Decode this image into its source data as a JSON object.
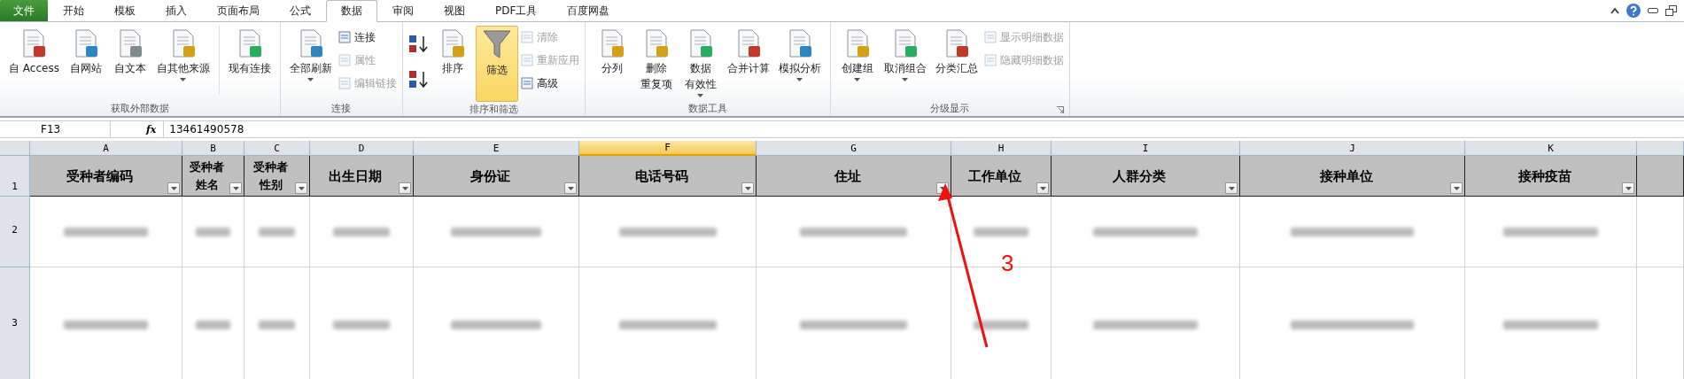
{
  "tabs": [
    {
      "label": "文件",
      "kind": "file",
      "selected": false
    },
    {
      "label": "开始",
      "kind": "tab",
      "selected": false
    },
    {
      "label": "模板",
      "kind": "tab",
      "selected": false
    },
    {
      "label": "插入",
      "kind": "tab",
      "selected": false
    },
    {
      "label": "页面布局",
      "kind": "tab",
      "selected": false
    },
    {
      "label": "公式",
      "kind": "tab",
      "selected": false
    },
    {
      "label": "数据",
      "kind": "tab",
      "selected": true
    },
    {
      "label": "审阅",
      "kind": "tab",
      "selected": false
    },
    {
      "label": "视图",
      "kind": "tab",
      "selected": false
    },
    {
      "label": "PDF工具",
      "kind": "tab",
      "selected": false
    },
    {
      "label": "百度网盘",
      "kind": "tab",
      "selected": false
    }
  ],
  "ribbon_groups": [
    {
      "label": "获取外部数据",
      "launcher": false,
      "items": [
        {
          "kind": "large",
          "label": "自 Access",
          "dropdown": false,
          "disabled": false
        },
        {
          "kind": "large",
          "label": "自网站",
          "dropdown": false,
          "disabled": false
        },
        {
          "kind": "large",
          "label": "自文本",
          "dropdown": false,
          "disabled": false
        },
        {
          "kind": "large",
          "label": "自其他来源",
          "dropdown": true,
          "disabled": false
        },
        {
          "kind": "separator"
        },
        {
          "kind": "large",
          "label": "现有连接",
          "dropdown": false,
          "disabled": false
        }
      ]
    },
    {
      "label": "连接",
      "launcher": false,
      "items": [
        {
          "kind": "large",
          "label": "全部刷新",
          "dropdown": true,
          "disabled": false
        },
        {
          "kind": "stack",
          "items": [
            {
              "label": "连接",
              "disabled": false
            },
            {
              "label": "属性",
              "disabled": true
            },
            {
              "label": "编辑链接",
              "disabled": true
            }
          ]
        }
      ]
    },
    {
      "label": "排序和筛选",
      "launcher": false,
      "items": [
        {
          "kind": "sort"
        },
        {
          "kind": "large",
          "label": "排序",
          "dropdown": false,
          "disabled": false
        },
        {
          "kind": "toggle",
          "label": "筛选",
          "selected": true
        },
        {
          "kind": "stack",
          "items": [
            {
              "label": "清除",
              "disabled": true
            },
            {
              "label": "重新应用",
              "disabled": true
            },
            {
              "label": "高级",
              "disabled": false
            }
          ]
        }
      ]
    },
    {
      "label": "数据工具",
      "launcher": false,
      "items": [
        {
          "kind": "large",
          "label": "分列",
          "dropdown": false,
          "disabled": false
        },
        {
          "kind": "large",
          "lines": [
            "删除",
            "重复项"
          ],
          "dropdown": false,
          "disabled": false
        },
        {
          "kind": "large",
          "lines": [
            "数据",
            "有效性"
          ],
          "dropdown": true,
          "disabled": false
        },
        {
          "kind": "large",
          "label": "合并计算",
          "dropdown": false,
          "disabled": false
        },
        {
          "kind": "large",
          "label": "模拟分析",
          "dropdown": true,
          "disabled": false
        }
      ]
    },
    {
      "label": "分级显示",
      "launcher": true,
      "items": [
        {
          "kind": "large",
          "label": "创建组",
          "dropdown": true,
          "disabled": false
        },
        {
          "kind": "large",
          "label": "取消组合",
          "dropdown": true,
          "disabled": false
        },
        {
          "kind": "large",
          "label": "分类汇总",
          "dropdown": false,
          "disabled": false
        },
        {
          "kind": "stack",
          "items": [
            {
              "label": "显示明细数据",
              "disabled": true
            },
            {
              "label": "隐藏明细数据",
              "disabled": true
            }
          ]
        }
      ]
    }
  ],
  "formula_bar": {
    "name_box": "F13",
    "fx": "fx",
    "value": "13461490578"
  },
  "columns": [
    {
      "letter": "A",
      "header": "受种者编码",
      "selected": false
    },
    {
      "letter": "B",
      "header": "受种者姓名",
      "selected": false
    },
    {
      "letter": "C",
      "header": "受种者性别",
      "selected": false
    },
    {
      "letter": "D",
      "header": "出生日期",
      "selected": false
    },
    {
      "letter": "E",
      "header": "身份证",
      "selected": false
    },
    {
      "letter": "F",
      "header": "电话号码",
      "selected": true
    },
    {
      "letter": "G",
      "header": "住址",
      "selected": false
    },
    {
      "letter": "H",
      "header": "工作单位",
      "selected": false
    },
    {
      "letter": "I",
      "header": "人群分类",
      "selected": false
    },
    {
      "letter": "J",
      "header": "接种单位",
      "selected": false
    },
    {
      "letter": "K",
      "header": "接种疫苗",
      "selected": false
    }
  ],
  "header_row_number": "1",
  "rows": [
    {
      "number": "2",
      "redacted": true
    },
    {
      "number": "3",
      "redacted": true
    }
  ],
  "annotation": {
    "label": "3"
  }
}
